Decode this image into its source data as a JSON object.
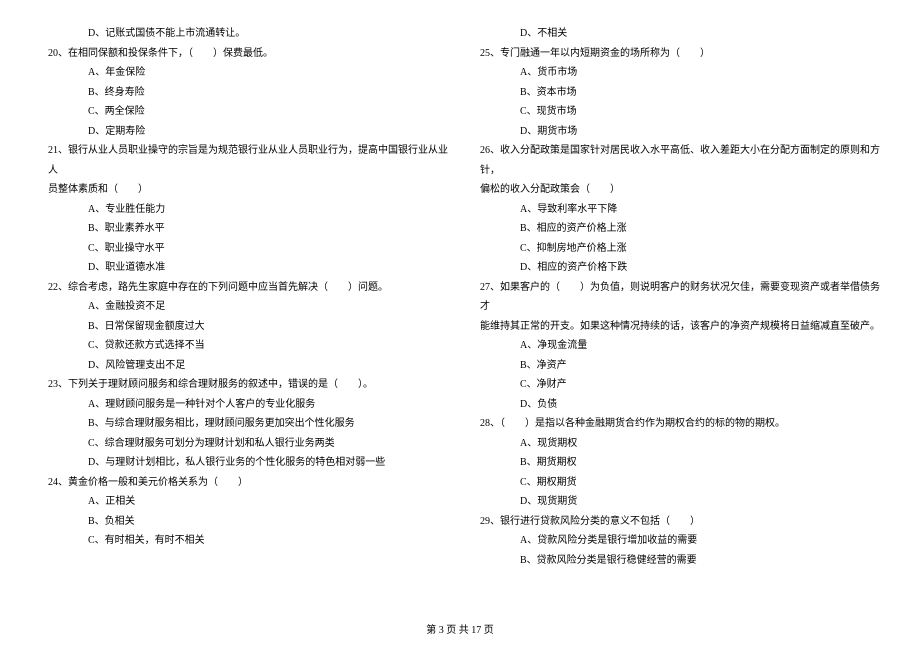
{
  "left": {
    "q19_d": "D、记账式国债不能上市流通转让。",
    "q20": "20、在相同保额和投保条件下，（　　）保费最低。",
    "q20_a": "A、年金保险",
    "q20_b": "B、终身寿险",
    "q20_c": "C、两全保险",
    "q20_d": "D、定期寿险",
    "q21": "21、银行从业人员职业操守的宗旨是为规范银行业从业人员职业行为，提高中国银行业从业人",
    "q21_cont": "员整体素质和（　　）",
    "q21_a": "A、专业胜任能力",
    "q21_b": "B、职业素养水平",
    "q21_c": "C、职业操守水平",
    "q21_d": "D、职业道德水准",
    "q22": "22、综合考虑，路先生家庭中存在的下列问题中应当首先解决（　　）问题。",
    "q22_a": "A、金融投资不足",
    "q22_b": "B、日常保留现金额度过大",
    "q22_c": "C、贷款还款方式选择不当",
    "q22_d": "D、风险管理支出不足",
    "q23": "23、下列关于理财顾问服务和综合理财服务的叙述中，错误的是（　　）。",
    "q23_a": "A、理财顾问服务是一种针对个人客户的专业化服务",
    "q23_b": "B、与综合理财服务相比，理财顾问服务更加突出个性化服务",
    "q23_c": "C、综合理财服务可划分为理财计划和私人银行业务两类",
    "q23_d": "D、与理财计划相比，私人银行业务的个性化服务的特色相对弱一些",
    "q24": "24、黄金价格一般和美元价格关系为（　　）",
    "q24_a": "A、正相关",
    "q24_b": "B、负相关",
    "q24_c": "C、有时相关，有时不相关"
  },
  "right": {
    "q24_d": "D、不相关",
    "q25": "25、专门融通一年以内短期资金的场所称为（　　）",
    "q25_a": "A、货币市场",
    "q25_b": "B、资本市场",
    "q25_c": "C、现货市场",
    "q25_d": "D、期货市场",
    "q26": "26、收入分配政策是国家针对居民收入水平高低、收入差距大小在分配方面制定的原则和方针，",
    "q26_cont": "偏松的收入分配政策会（　　）",
    "q26_a": "A、导致利率水平下降",
    "q26_b": "B、相应的资产价格上涨",
    "q26_c": "C、抑制房地产价格上涨",
    "q26_d": "D、相应的资产价格下跌",
    "q27": "27、如果客户的（　　）为负值，则说明客户的财务状况欠佳，需要变现资产或者举借债务才",
    "q27_cont": "能维持其正常的开支。如果这种情况持续的话，该客户的净资产规模将日益缩减直至破产。",
    "q27_a": "A、净现金流量",
    "q27_b": "B、净资产",
    "q27_c": "C、净财产",
    "q27_d": "D、负债",
    "q28": "28、（　　）是指以各种金融期货合约作为期权合约的标的物的期权。",
    "q28_a": "A、现货期权",
    "q28_b": "B、期货期权",
    "q28_c": "C、期权期货",
    "q28_d": "D、现货期货",
    "q29": "29、银行进行贷款风险分类的意义不包括（　　）",
    "q29_a": "A、贷款风险分类是银行增加收益的需要",
    "q29_b": "B、贷款风险分类是银行稳健经营的需要"
  },
  "footer": "第 3 页 共 17 页"
}
